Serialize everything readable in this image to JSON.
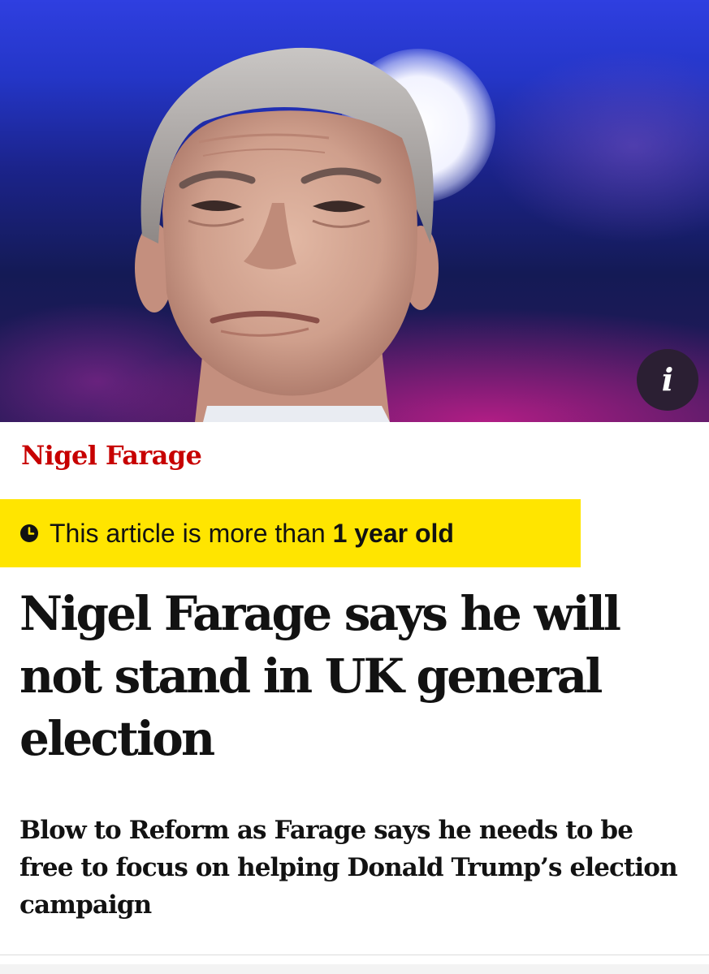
{
  "hero": {
    "image_alt": "Nigel Farage",
    "info_label": "i"
  },
  "article": {
    "kicker": "Nigel Farage",
    "age_warning": {
      "icon": "clock-icon",
      "prefix": "This article is more than ",
      "emphasis": "1 year old"
    },
    "headline": "Nigel Farage says he will not stand in UK general election",
    "standfirst": "Blow to Reform as Farage says he needs to be free to focus on helping Donald Trump’s election campaign"
  },
  "colors": {
    "kicker": "#c70000",
    "age_banner": "#ffe500",
    "text": "#121212"
  }
}
